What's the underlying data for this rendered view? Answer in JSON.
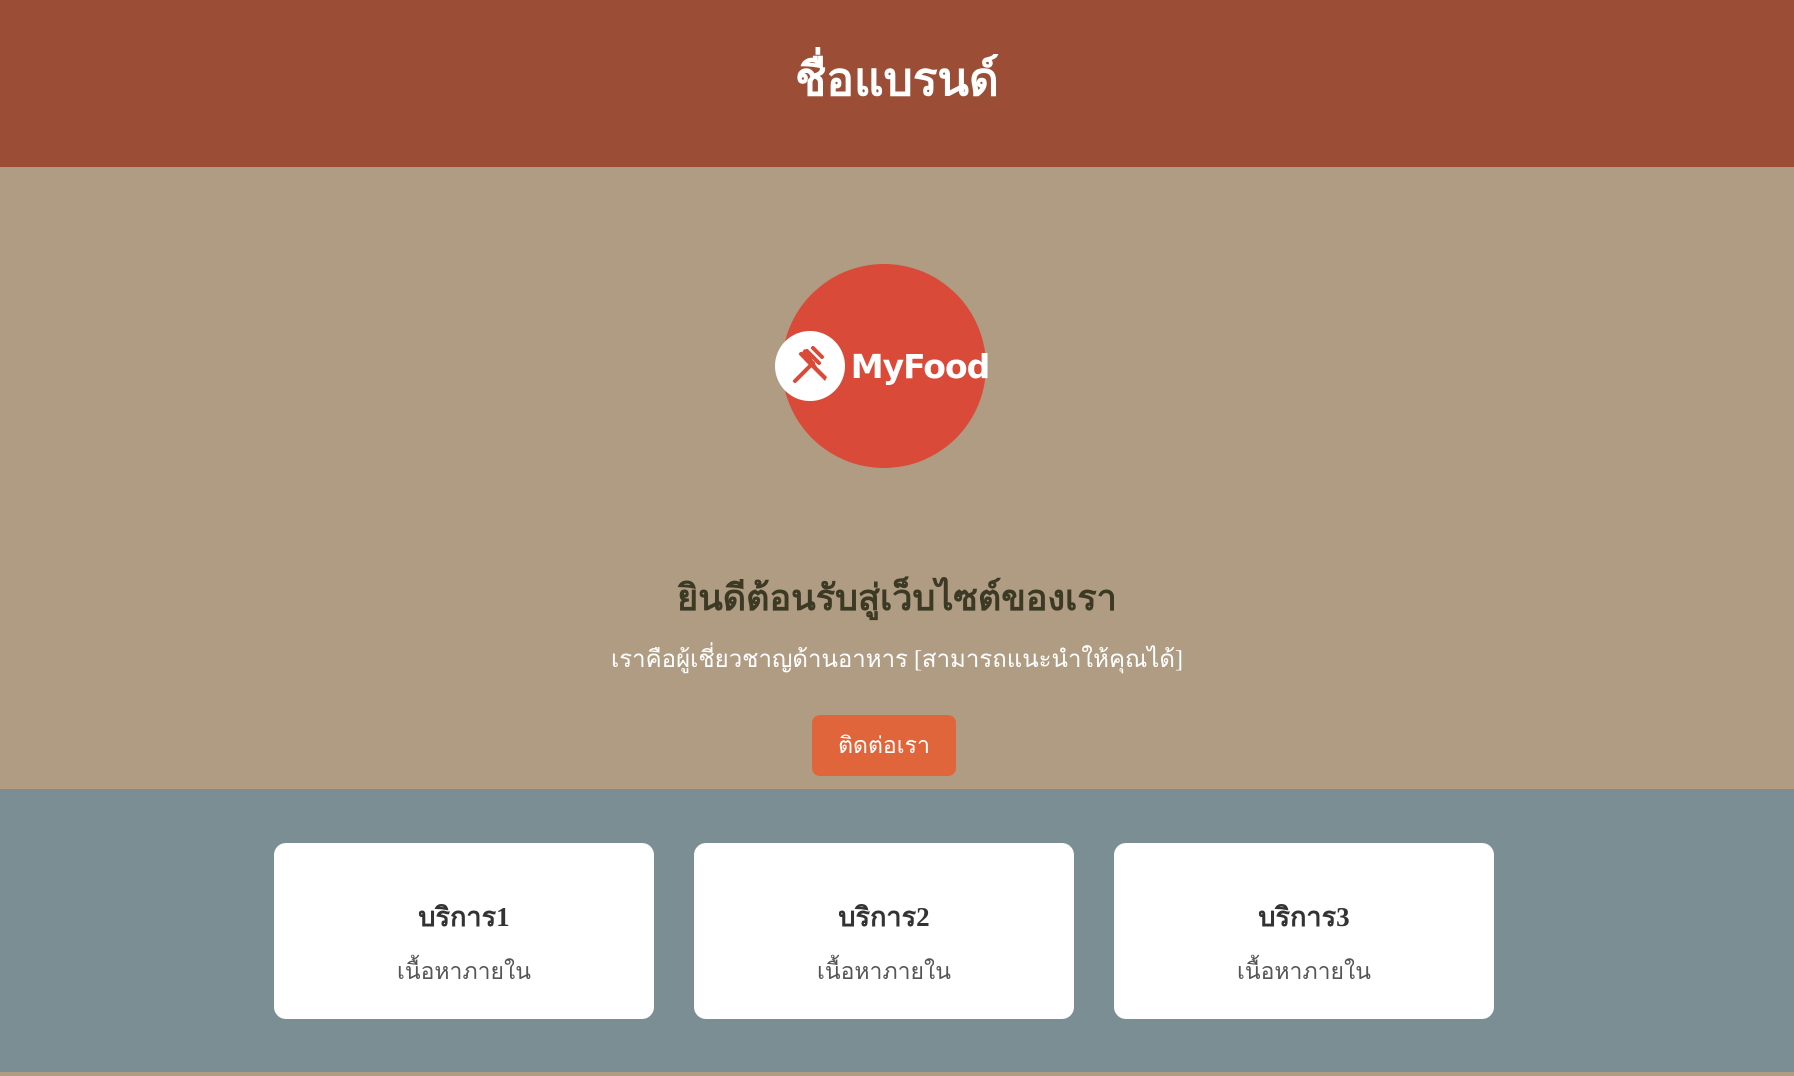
{
  "header": {
    "brand_name": "ชื่อแบรนด์"
  },
  "hero": {
    "logo": {
      "text": "MyFood",
      "icon": "fork-knife-icon",
      "color": "#d94a39"
    },
    "title": "ยินดีต้อนรับสู่เว็บไซต์ของเรา",
    "subtitle": "เราคือผู้เชี่ยวชาญด้านอาหาร [สามารถแนะนำให้คุณได้]",
    "cta_label": "ติดต่อเรา"
  },
  "services": [
    {
      "title": "บริการ1",
      "description": "เนื้อหาภายใน"
    },
    {
      "title": "บริการ2",
      "description": "เนื้อหาภายใน"
    },
    {
      "title": "บริการ3",
      "description": "เนื้อหาภายใน"
    }
  ],
  "colors": {
    "header_bg": "#9b4e35",
    "hero_bg": "#af9c83",
    "services_bg": "#7b8e94",
    "accent": "#e0653a"
  }
}
